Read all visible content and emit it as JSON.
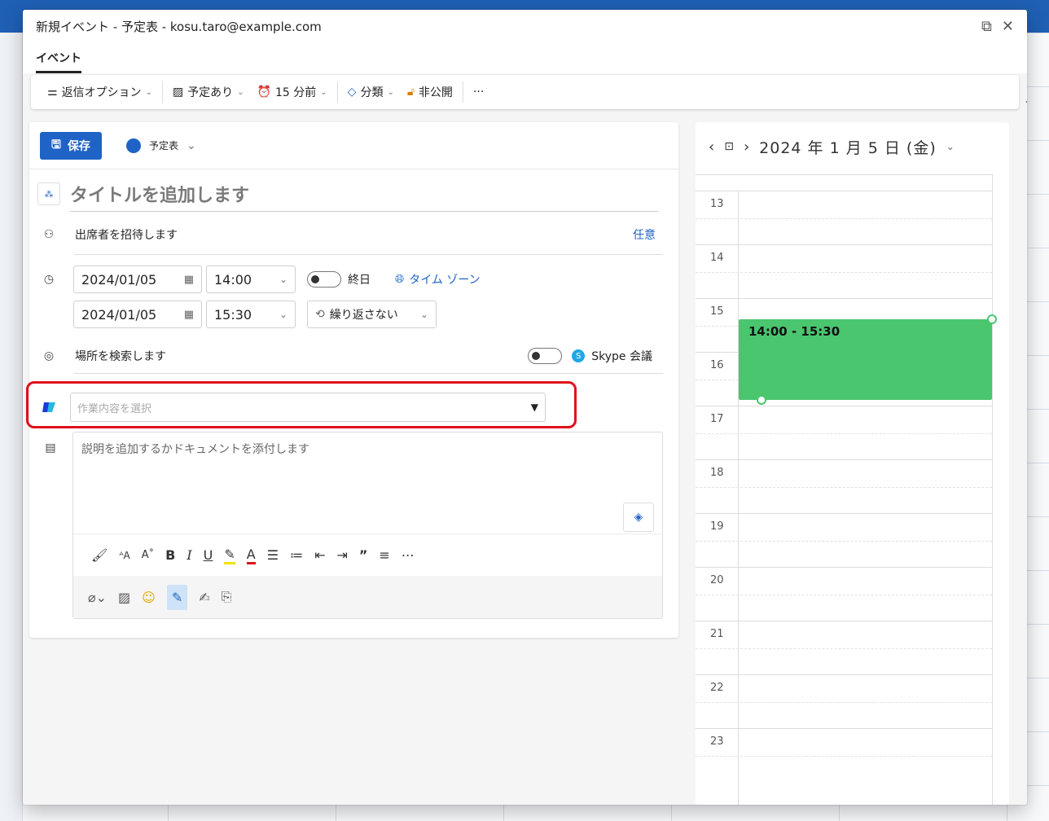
{
  "window": {
    "title": "新規イベント - 予定表 - kosu.taro@example.com",
    "tab": "イベント"
  },
  "toolbar": {
    "response_options": "返信オプション",
    "busy": "予定あり",
    "reminder": "15 分前",
    "category": "分類",
    "private": "非公開",
    "more": "···"
  },
  "form": {
    "save_label": "保存",
    "calendar_name": "予定表",
    "title_placeholder": "タイトルを追加します",
    "attendees_placeholder": "出席者を招待します",
    "optional_label": "任意",
    "start_date": "2024/01/05",
    "start_time": "14:00",
    "end_date": "2024/01/05",
    "end_time": "15:30",
    "all_day_label": "終日",
    "timezone_label": "タイム ゾーン",
    "repeat_label": "繰り返さない",
    "location_placeholder": "場所を検索します",
    "skype_label": "Skype 会議",
    "task_placeholder": "作業内容を選択",
    "description_placeholder": "説明を追加するかドキュメントを添付します"
  },
  "calendar": {
    "date_label": "2024 年 1 月 5 日 (金)",
    "hours": [
      "13",
      "14",
      "15",
      "16",
      "17",
      "18",
      "19",
      "20",
      "21",
      "22",
      "23"
    ],
    "event_time": "14:00 - 15:30",
    "event_color": "#4ac66f"
  },
  "colors": {
    "accent": "#1f63c6",
    "highlight": "#e0101b"
  }
}
